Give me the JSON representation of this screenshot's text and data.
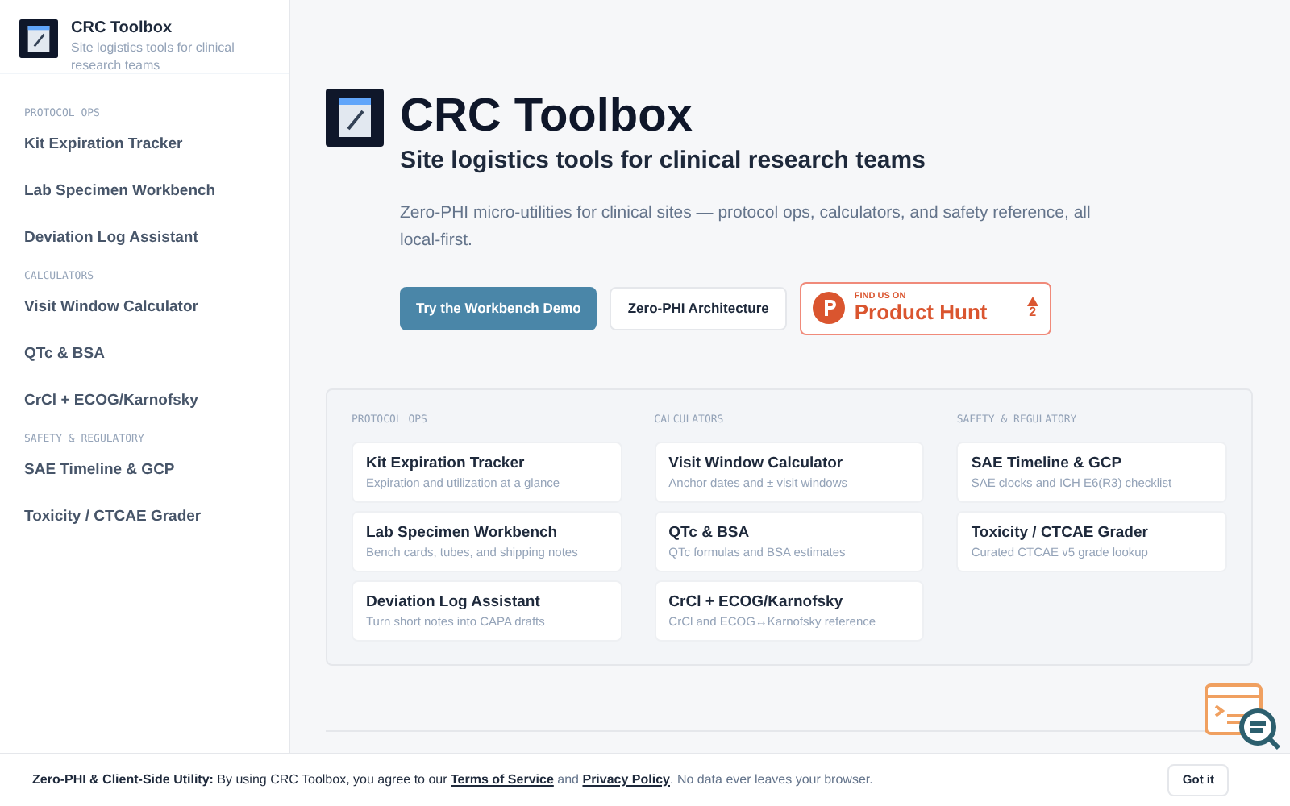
{
  "sidebar": {
    "title": "CRC Toolbox",
    "subtitle": "Site logistics tools for clinical research teams",
    "sections": [
      {
        "heading": "PROTOCOL OPS",
        "items": [
          "Kit Expiration Tracker",
          "Lab Specimen Workbench",
          "Deviation Log Assistant"
        ]
      },
      {
        "heading": "CALCULATORS",
        "items": [
          "Visit Window Calculator",
          "QTc & BSA",
          "CrCl + ECOG/Karnofsky"
        ]
      },
      {
        "heading": "SAFETY & REGULATORY",
        "items": [
          "SAE Timeline & GCP",
          "Toxicity / CTCAE Grader"
        ]
      }
    ]
  },
  "hero": {
    "title": "CRC Toolbox",
    "subtitle": "Site logistics tools for clinical research teams",
    "description": "Zero-PHI micro-utilities for clinical sites — protocol ops, calculators, and safety reference, all local-first.",
    "buttons": [
      {
        "kind": "primary",
        "label": "Try the Workbench Demo"
      },
      {
        "kind": "secondary",
        "label": "Zero-PHI Architecture"
      }
    ],
    "badge": {
      "kicker": "FIND US ON",
      "name": "Product Hunt",
      "votes": "2"
    }
  },
  "tool_groups": [
    {
      "heading": "PROTOCOL OPS",
      "tools": [
        {
          "name": "Kit Expiration Tracker",
          "description": "Expiration and utilization at a glance"
        },
        {
          "name": "Lab Specimen Workbench",
          "description": "Bench cards, tubes, and shipping notes"
        },
        {
          "name": "Deviation Log Assistant",
          "description": "Turn short notes into CAPA drafts"
        }
      ]
    },
    {
      "heading": "CALCULATORS",
      "tools": [
        {
          "name": "Visit Window Calculator",
          "description": "Anchor dates and ± visit windows"
        },
        {
          "name": "QTc & BSA",
          "description": "QTc formulas and BSA estimates"
        },
        {
          "name": "CrCl + ECOG/Karnofsky",
          "description": "CrCl and ECOG↔Karnofsky reference"
        }
      ]
    },
    {
      "heading": "SAFETY & REGULATORY",
      "tools": [
        {
          "name": "SAE Timeline & GCP",
          "description": "SAE clocks and ICH E6(R3) checklist"
        },
        {
          "name": "Toxicity / CTCAE Grader",
          "description": "Curated CTCAE v5 grade lookup"
        }
      ]
    }
  ],
  "consent_banner": {
    "text": "**Zero-PHI & Client-Side Utility:** By using CRC Toolbox, you agree to our",
    "terms_link": "Terms of Service",
    "joiner": "and",
    "privacy_link": "Privacy Policy",
    "tail": ". No data ever leaves your browser.",
    "button": "Got it"
  }
}
